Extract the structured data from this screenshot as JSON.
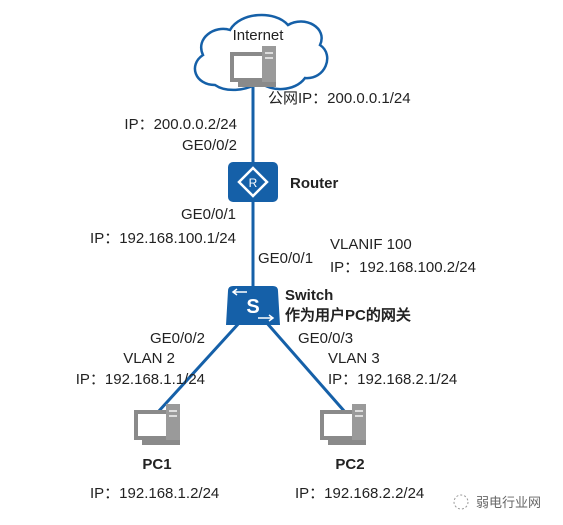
{
  "colors": {
    "accent": "#1560a8",
    "icon_gray": "#8a8a8a"
  },
  "internet": {
    "label": "Internet",
    "public_ip": "公网IP：200.0.0.1/24"
  },
  "router": {
    "label": "Router",
    "icon": "router-icon",
    "up_ip": "IP：200.0.0.2/24",
    "up_port": "GE0/0/2",
    "down_port": "GE0/0/1",
    "down_ip": "IP：192.168.100.1/24"
  },
  "switch": {
    "label": "Switch",
    "note": "作为用户PC的网关",
    "icon": "switch-icon",
    "up_port": "GE0/0/1",
    "vlanif": "VLANIF 100",
    "vlanif_ip": "IP：192.168.100.2/24",
    "left": {
      "port": "GE0/0/2",
      "vlan": "VLAN 2",
      "ip": "IP：192.168.1.1/24"
    },
    "right": {
      "port": "GE0/0/3",
      "vlan": "VLAN 3",
      "ip": "IP：192.168.2.1/24"
    }
  },
  "pcs": [
    {
      "label": "PC1",
      "ip": "IP：192.168.1.2/24"
    },
    {
      "label": "PC2",
      "ip": "IP：192.168.2.2/24"
    }
  ],
  "watermark": "弱电行业网"
}
